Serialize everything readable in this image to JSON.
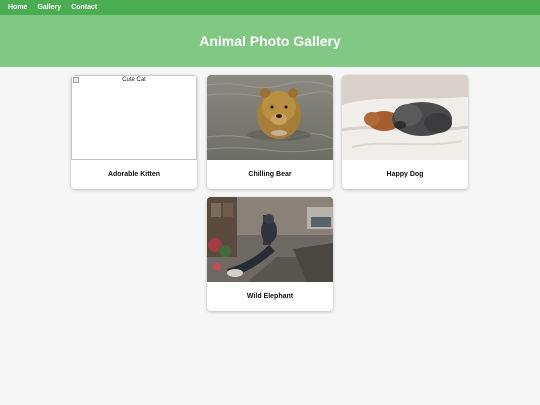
{
  "nav": {
    "home": "Home",
    "gallery": "Gallery",
    "contact": "Contact"
  },
  "header": {
    "title": "Animal Photo Gallery"
  },
  "colors": {
    "navbar": "#4aad52",
    "hero": "#80c883",
    "background": "#f6f6f6"
  },
  "cards": [
    {
      "label": "Adorable Kitten",
      "image_alt": "Cute Cat",
      "image_state": "broken"
    },
    {
      "label": "Chilling Bear",
      "image": "bear-in-water-photo"
    },
    {
      "label": "Happy Dog",
      "image": "dog-sleeping-on-bed-photo"
    },
    {
      "label": "Wild Elephant",
      "image": "cat-on-street-photo"
    }
  ]
}
